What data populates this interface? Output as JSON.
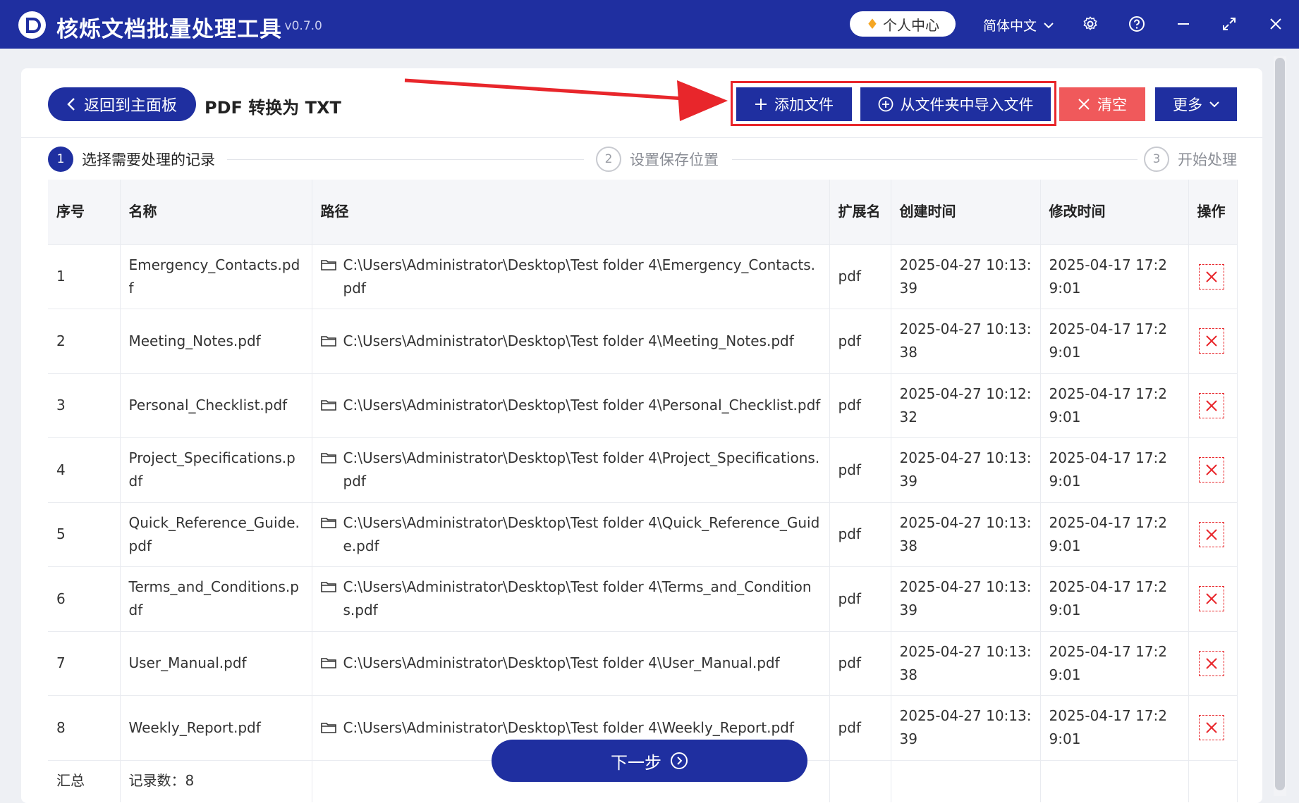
{
  "app": {
    "title": "核烁文档批量处理工具",
    "version": "- v0.7.0",
    "personal_center": "个人中心",
    "language": "简体中文"
  },
  "toolbar": {
    "back_label": "返回到主面板",
    "page_title": "PDF 转换为 TXT",
    "add_file_label": "添加文件",
    "import_folder_label": "从文件夹中导入文件",
    "clear_label": "清空",
    "more_label": "更多"
  },
  "steps": [
    {
      "num": "1",
      "label": "选择需要处理的记录"
    },
    {
      "num": "2",
      "label": "设置保存位置"
    },
    {
      "num": "3",
      "label": "开始处理"
    }
  ],
  "table": {
    "headers": {
      "index": "序号",
      "name": "名称",
      "path": "路径",
      "ext": "扩展名",
      "created": "创建时间",
      "modified": "修改时间",
      "action": "操作"
    },
    "rows": [
      {
        "index": "1",
        "name": "Emergency_Contacts.pdf",
        "path": "C:\\Users\\Administrator\\Desktop\\Test folder 4\\Emergency_Contacts.pdf",
        "ext": "pdf",
        "created": "2025-04-27 10:13:39",
        "modified": "2025-04-17 17:29:01"
      },
      {
        "index": "2",
        "name": "Meeting_Notes.pdf",
        "path": "C:\\Users\\Administrator\\Desktop\\Test folder 4\\Meeting_Notes.pdf",
        "ext": "pdf",
        "created": "2025-04-27 10:13:38",
        "modified": "2025-04-17 17:29:01"
      },
      {
        "index": "3",
        "name": "Personal_Checklist.pdf",
        "path": "C:\\Users\\Administrator\\Desktop\\Test folder 4\\Personal_Checklist.pdf",
        "ext": "pdf",
        "created": "2025-04-27 10:12:32",
        "modified": "2025-04-17 17:29:01"
      },
      {
        "index": "4",
        "name": "Project_Specifications.pdf",
        "path": "C:\\Users\\Administrator\\Desktop\\Test folder 4\\Project_Specifications.pdf",
        "ext": "pdf",
        "created": "2025-04-27 10:13:39",
        "modified": "2025-04-17 17:29:01"
      },
      {
        "index": "5",
        "name": "Quick_Reference_Guide.pdf",
        "path": "C:\\Users\\Administrator\\Desktop\\Test folder 4\\Quick_Reference_Guide.pdf",
        "ext": "pdf",
        "created": "2025-04-27 10:13:38",
        "modified": "2025-04-17 17:29:01"
      },
      {
        "index": "6",
        "name": "Terms_and_Conditions.pdf",
        "path": "C:\\Users\\Administrator\\Desktop\\Test folder 4\\Terms_and_Conditions.pdf",
        "ext": "pdf",
        "created": "2025-04-27 10:13:39",
        "modified": "2025-04-17 17:29:01"
      },
      {
        "index": "7",
        "name": "User_Manual.pdf",
        "path": "C:\\Users\\Administrator\\Desktop\\Test folder 4\\User_Manual.pdf",
        "ext": "pdf",
        "created": "2025-04-27 10:13:38",
        "modified": "2025-04-17 17:29:01"
      },
      {
        "index": "8",
        "name": "Weekly_Report.pdf",
        "path": "C:\\Users\\Administrator\\Desktop\\Test folder 4\\Weekly_Report.pdf",
        "ext": "pdf",
        "created": "2025-04-27 10:13:39",
        "modified": "2025-04-17 17:29:01"
      }
    ],
    "summary_label": "汇总",
    "summary_count": "记录数：8"
  },
  "next_label": "下一步",
  "colors": {
    "brand": "#1f2fa0",
    "danger": "#f0595b",
    "highlight": "#e8262b"
  }
}
